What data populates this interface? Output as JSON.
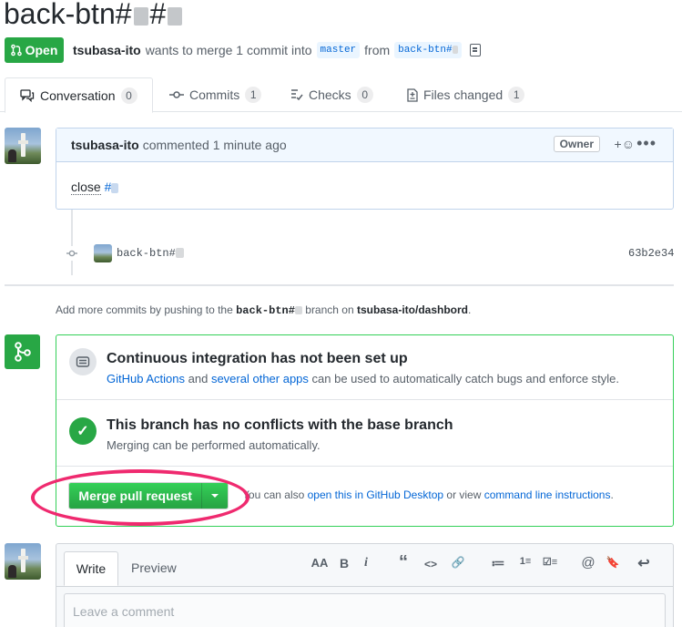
{
  "pr": {
    "title_prefix": "back-btn#",
    "title_hash": "#",
    "status": "Open",
    "author": "tsubasa-ito",
    "meta_text": "wants to merge 1 commit into",
    "base_branch": "master",
    "from_text": "from",
    "head_branch": "back-btn#"
  },
  "tabs": [
    {
      "label": "Conversation",
      "count": "0",
      "icon": "comment-discussion-icon"
    },
    {
      "label": "Commits",
      "count": "1",
      "icon": "git-commit-icon"
    },
    {
      "label": "Checks",
      "count": "0",
      "icon": "checklist-icon"
    },
    {
      "label": "Files changed",
      "count": "1",
      "icon": "file-diff-icon"
    }
  ],
  "comment": {
    "author": "tsubasa-ito",
    "action": "commented 1 minute ago",
    "role": "Owner",
    "react": "+☺",
    "body_prefix": "close",
    "body_link": "#"
  },
  "commit": {
    "message": "back-btn#",
    "sha": "63b2e34"
  },
  "add_commits": {
    "prefix": "Add more commits by pushing to the",
    "branch": "back-btn#",
    "middle": "branch on",
    "repo": "tsubasa-ito/dashbord",
    "suffix": "."
  },
  "merge": {
    "ci_title": "Continuous integration has not been set up",
    "ci_link1": "GitHub Actions",
    "ci_and": "and",
    "ci_link2": "several other apps",
    "ci_rest": "can be used to automatically catch bugs and enforce style.",
    "ok_title": "This branch has no conflicts with the base branch",
    "ok_sub": "Merging can be performed automatically.",
    "button": "Merge pull request",
    "alt_prefix": "You can also",
    "alt_link1": "open this in GitHub Desktop",
    "alt_mid": "or view",
    "alt_link2": "command line instructions",
    "alt_suffix": "."
  },
  "editor": {
    "tab_write": "Write",
    "tab_preview": "Preview",
    "placeholder": "Leave a comment",
    "toolbar": [
      "AA",
      "B",
      "i",
      "“",
      "<>",
      "🔗",
      "≔",
      "1≡",
      "☑≡",
      "@",
      "🔖",
      "↩"
    ]
  },
  "colors": {
    "green": "#28a745",
    "link": "#0366d6",
    "highlight_ellipse": "#ef2a6f"
  }
}
